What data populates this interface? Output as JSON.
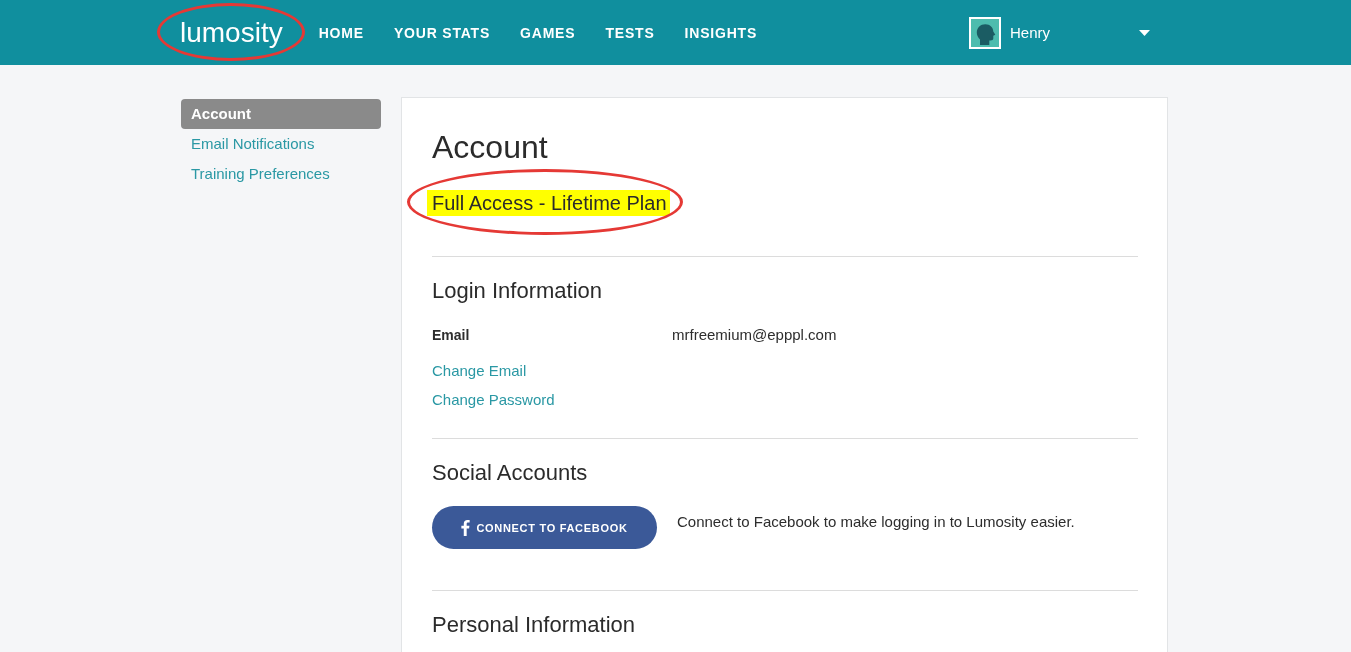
{
  "header": {
    "logo": {
      "text": "lumosity",
      "circled": true
    },
    "nav": [
      {
        "label": "HOME",
        "selected": false
      },
      {
        "label": "YOUR STATS",
        "selected": false
      },
      {
        "label": "GAMES",
        "selected": false
      },
      {
        "label": "TESTS",
        "selected": false
      },
      {
        "label": "INSIGHTS",
        "selected": false
      }
    ],
    "user": {
      "name": "Henry"
    }
  },
  "sidebar": {
    "items": [
      {
        "label": "Account",
        "selected": true
      },
      {
        "label": "Email Notifications",
        "selected": false
      },
      {
        "label": "Training Preferences",
        "selected": false
      }
    ]
  },
  "main": {
    "title": "Account",
    "plan": {
      "text": "Full Access - Lifetime Plan",
      "highlighted": true,
      "circled": true
    },
    "sections": [
      {
        "kind": "login",
        "heading": "Login Information",
        "fields": [
          {
            "label": "Email",
            "value": "mrfreemium@epppl.com"
          }
        ],
        "links": [
          "Change Email",
          "Change Password"
        ]
      },
      {
        "kind": "social",
        "heading": "Social Accounts",
        "button": "CONNECT TO FACEBOOK",
        "note": "Connect to Facebook to make logging in to Lumosity easier."
      },
      {
        "kind": "plain",
        "heading": "Personal Information"
      }
    ]
  }
}
